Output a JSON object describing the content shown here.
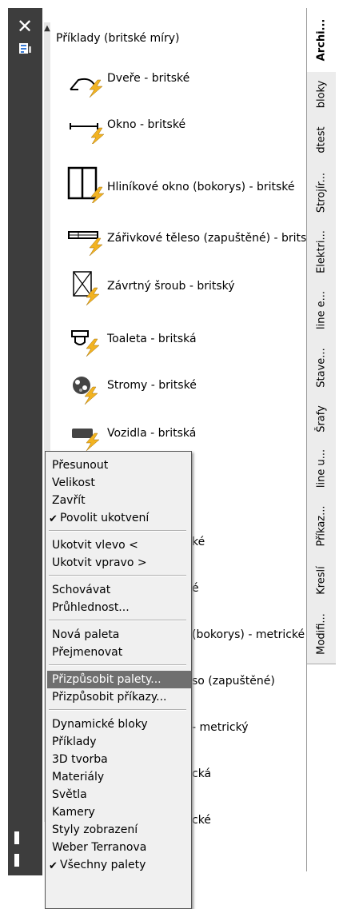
{
  "palette_title": "Příklady (britské míry)",
  "tools": [
    {
      "label": "Dveře - britské"
    },
    {
      "label": "Okno - britské"
    },
    {
      "label": "Hliníkové okno (bokorys) - britské"
    },
    {
      "label": "Zářivkové těleso (zapuštěné) - britské"
    },
    {
      "label": "Závrtný šroub - britský"
    },
    {
      "label": "Toaleta - britská"
    },
    {
      "label": "Stromy - britské"
    },
    {
      "label": "Vozidla - britská"
    }
  ],
  "hidden_fragments": [
    "ké",
    "é",
    "(bokorys) - metrické",
    "so (zapuštěné)",
    "- metrický",
    "cká",
    "cké"
  ],
  "tabs": [
    "Archi...",
    "bloky",
    "dtest",
    "Strojír...",
    "Elektri...",
    "line e...",
    "Stave...",
    "Šrafy",
    "line u...",
    "Příkaz...",
    "Kreslí",
    "Modifi..."
  ],
  "menu": {
    "group1": [
      "Přesunout",
      "Velikost",
      "Zavřít",
      "Povolit ukotvení"
    ],
    "group2": [
      "Ukotvit vlevo  <",
      "Ukotvit vpravo  >"
    ],
    "group3": [
      "Schovávat",
      "Průhlednost..."
    ],
    "group4": [
      "Nová paleta",
      "Přejmenovat"
    ],
    "group5": [
      "Přizpůsobit palety...",
      "Přizpůsobit příkazy..."
    ],
    "group6": [
      "Dynamické bloky",
      "Příklady",
      "3D tvorba",
      "Materiály",
      "Světla",
      "Kamery",
      "Styly zobrazení",
      "Weber Terranova",
      "Všechny palety"
    ]
  },
  "colors": {
    "titlebar": "#3d3d3d",
    "highlight": "#6f6f6f",
    "menu_bg": "#f0f0f0",
    "lightning": "#f2b321"
  }
}
